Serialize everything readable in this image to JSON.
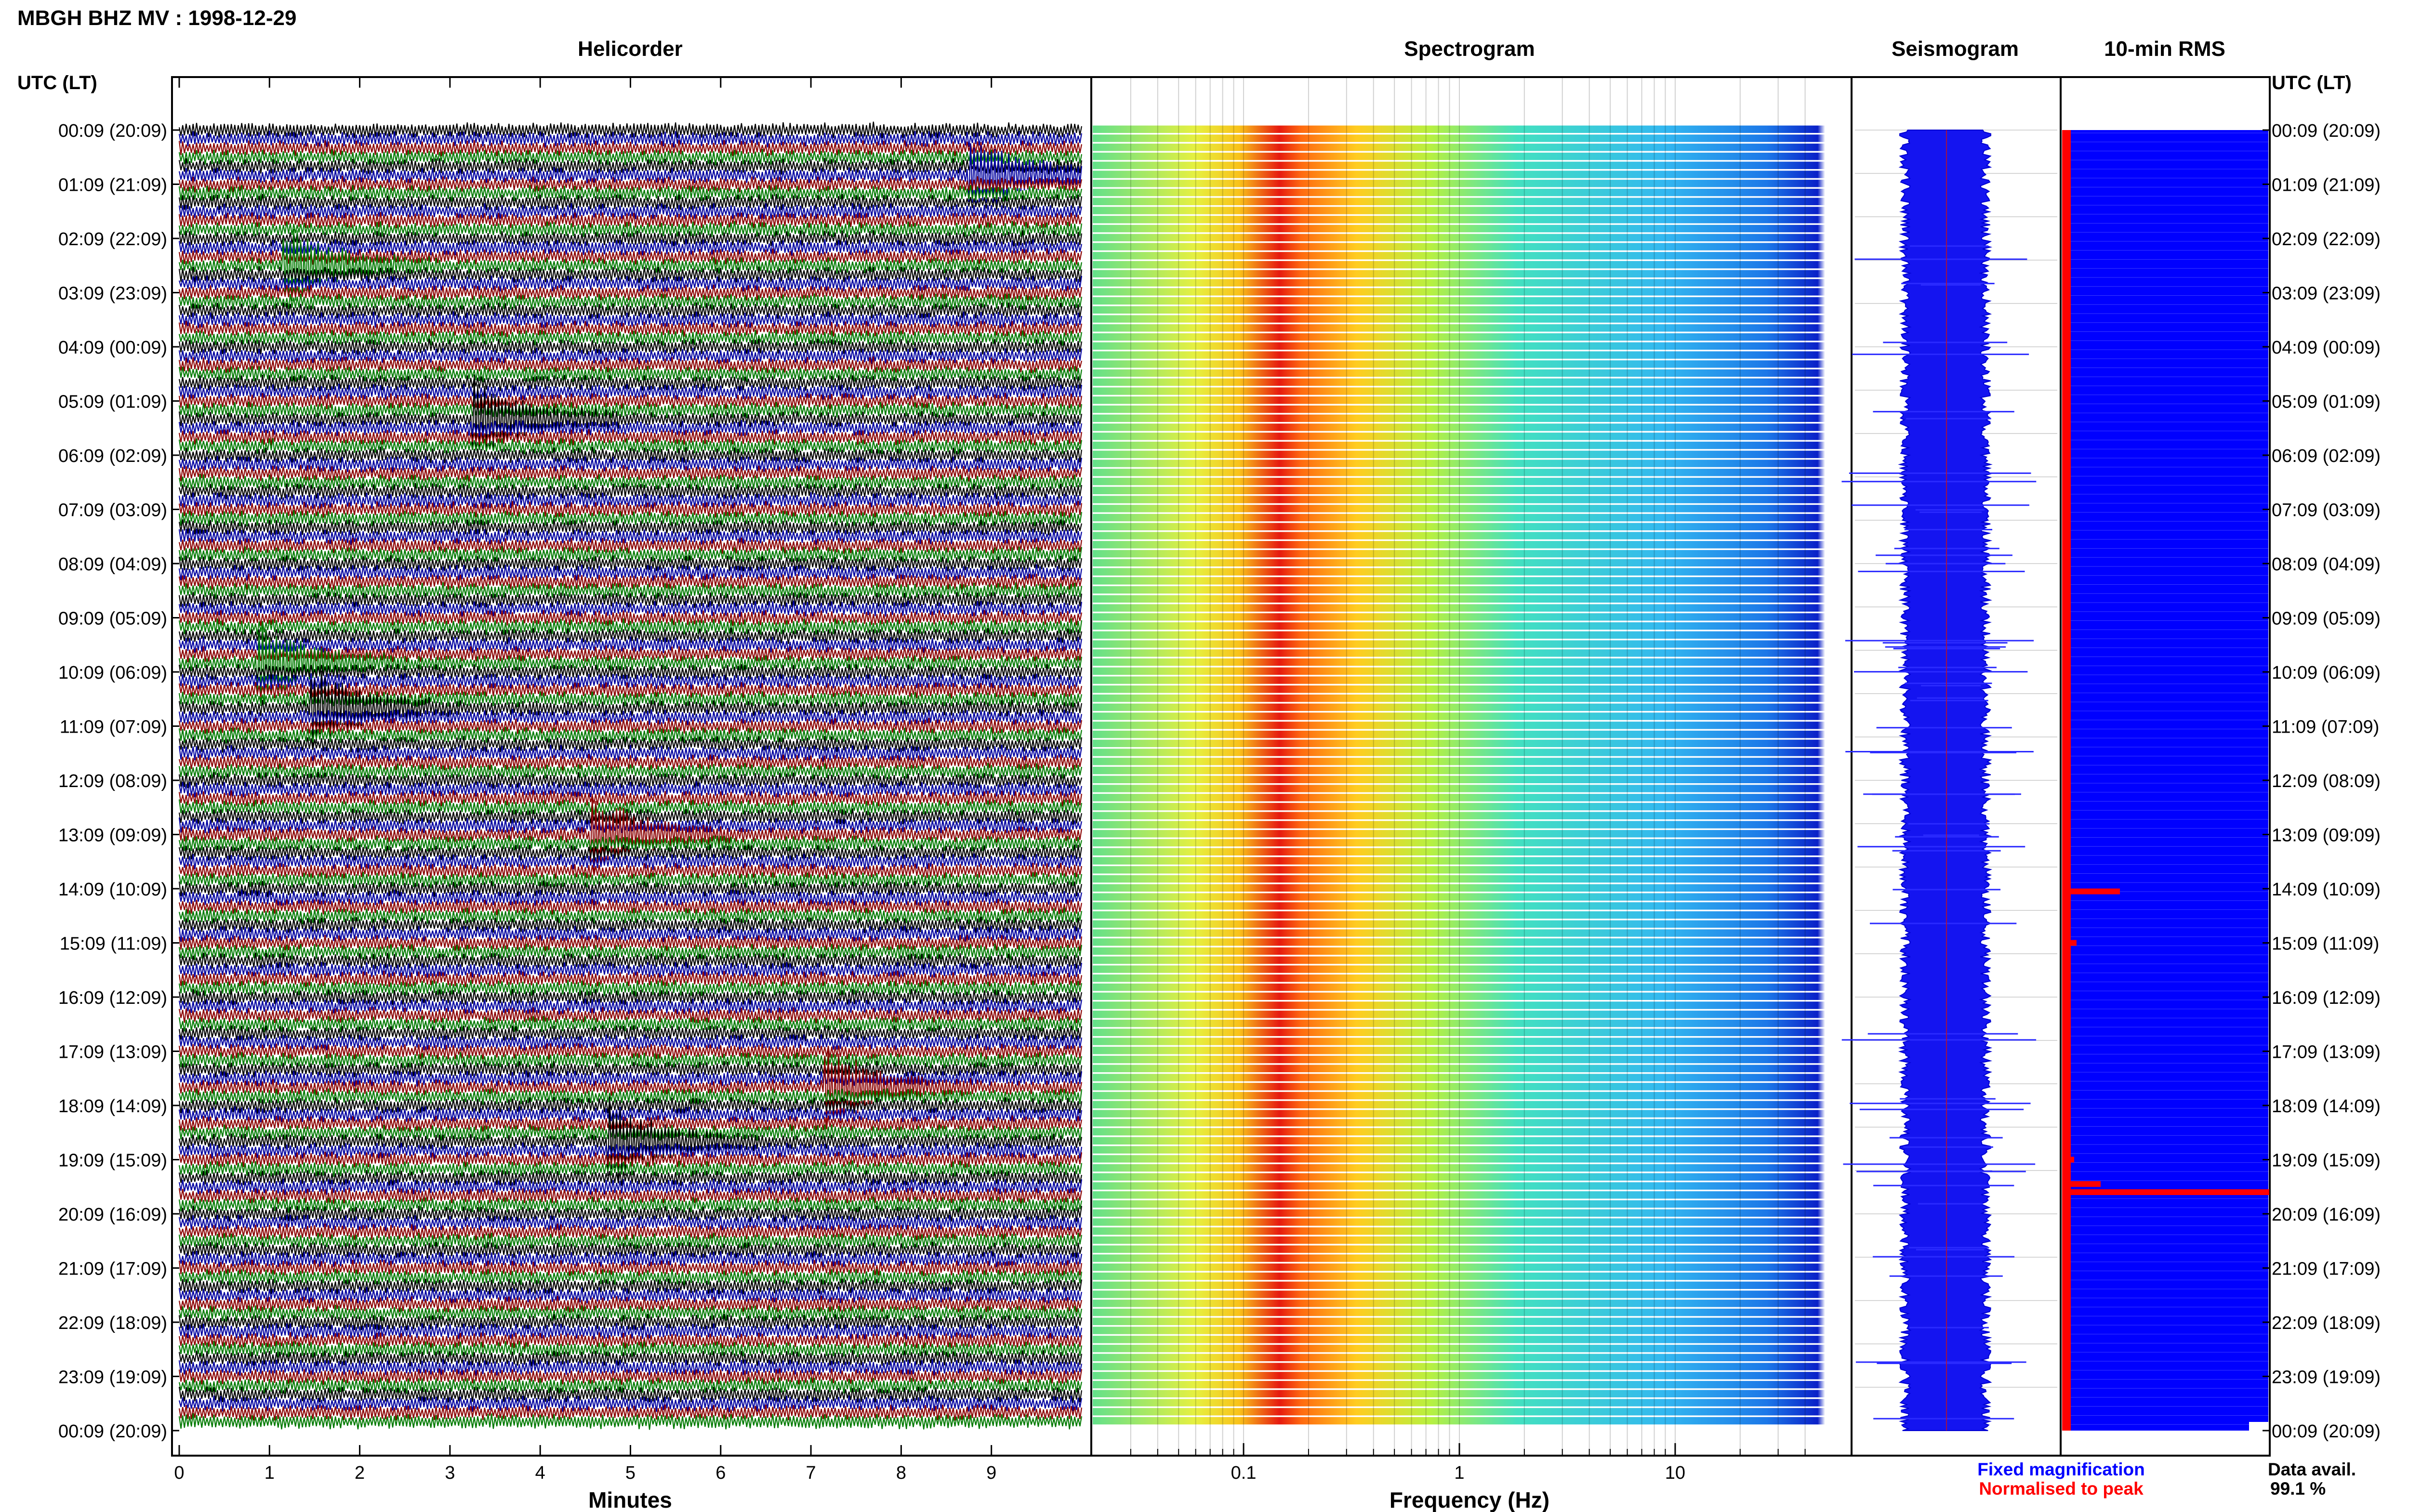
{
  "header": {
    "title": "MBGH BHZ MV : 1998-12-29",
    "utc_label": "UTC (LT)"
  },
  "panels": {
    "helicorder": "Helicorder",
    "spectrogram": "Spectrogram",
    "seismogram": "Seismogram",
    "rms": "10-min RMS"
  },
  "legend": {
    "fixed": "Fixed magnification",
    "normalised": "Normalised to peak",
    "avail_label": "Data avail.",
    "avail_value": "99.1 %"
  },
  "colors": {
    "trace_cycle": [
      "#000000",
      "#0000a0",
      "#8b0000",
      "#007a00"
    ],
    "fixed_magnification": "#0000ff",
    "normalised_to_peak": "#ff0000"
  },
  "chart_data": [
    {
      "type": "line",
      "title": "Helicorder",
      "xlabel": "Minutes",
      "x_ticks": [
        "0",
        "1",
        "2",
        "3",
        "4",
        "5",
        "6",
        "7",
        "8",
        "9"
      ],
      "xlim": [
        0,
        10
      ],
      "row_labels": [
        "00:09 (20:09)",
        "01:09 (21:09)",
        "02:09 (22:09)",
        "03:09 (23:09)",
        "04:09 (00:09)",
        "05:09 (01:09)",
        "06:09 (02:09)",
        "07:09 (03:09)",
        "08:09 (04:09)",
        "09:09 (05:09)",
        "10:09 (06:09)",
        "11:09 (07:09)",
        "12:09 (08:09)",
        "13:09 (09:09)",
        "14:09 (10:09)",
        "15:09 (11:09)",
        "16:09 (12:09)",
        "17:09 (13:09)",
        "18:09 (14:09)",
        "19:09 (15:09)",
        "20:09 (16:09)",
        "21:09 (17:09)",
        "22:09 (18:09)",
        "23:09 (19:09)",
        "00:09 (20:09)"
      ],
      "events": [
        {
          "hour": 0.9,
          "minute": 8.8,
          "series": "green"
        },
        {
          "hour": 2.5,
          "minute": 1.2,
          "series": "blue"
        },
        {
          "hour": 5.3,
          "minute": 3.3,
          "series": "green"
        },
        {
          "hour": 9.9,
          "minute": 0.9,
          "series": "green"
        },
        {
          "hour": 10.6,
          "minute": 1.5,
          "series": "red"
        },
        {
          "hour": 13.0,
          "minute": 4.6,
          "series": "green"
        },
        {
          "hour": 17.7,
          "minute": 7.2,
          "series": "red"
        },
        {
          "hour": 18.6,
          "minute": 4.8,
          "series": "green"
        }
      ]
    },
    {
      "type": "heatmap",
      "title": "Spectrogram",
      "xlabel": "Frequency (Hz)",
      "x_scale": "log",
      "xlim": [
        0.02,
        50
      ],
      "x_ticks": [
        "0.1",
        "1",
        "10"
      ],
      "peak_band_hz": [
        0.17,
        0.5
      ]
    },
    {
      "type": "line",
      "title": "Seismogram"
    },
    {
      "type": "bar",
      "title": "10-min RMS",
      "spikes_hours": [
        14.05,
        15.0,
        19.0,
        19.45,
        19.6
      ]
    }
  ]
}
